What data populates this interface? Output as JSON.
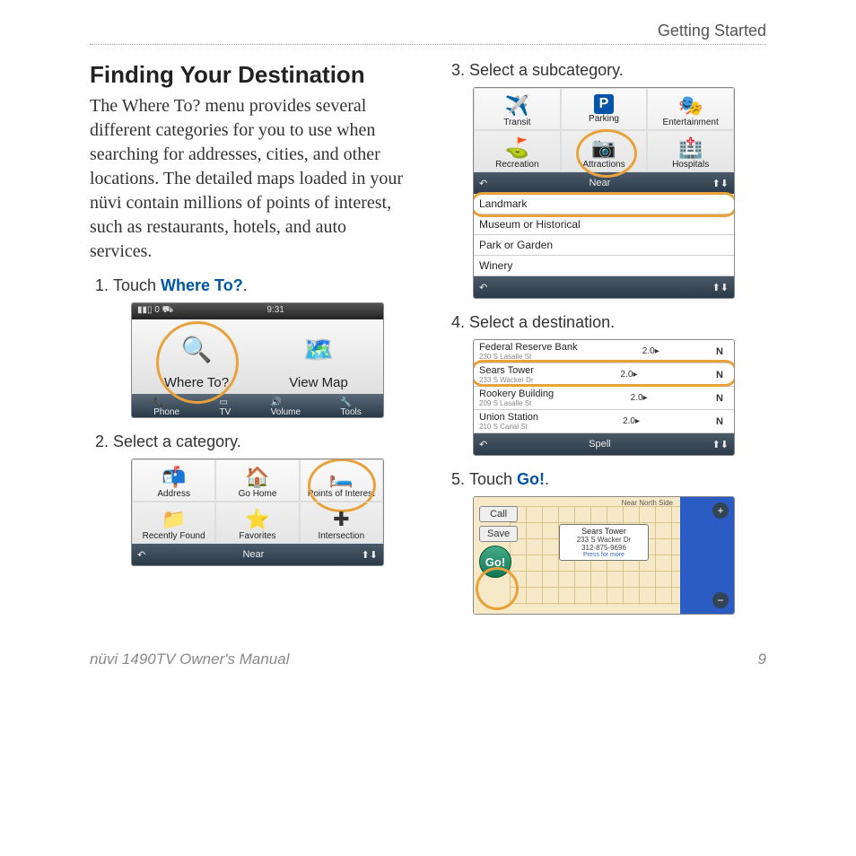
{
  "header": {
    "section": "Getting Started"
  },
  "title": "Finding Your Destination",
  "intro": "The Where To? menu provides several different categories for you to use when searching for addresses, cities, and other locations. The detailed maps loaded in your nüvi contain millions of points of interest, such as restaurants, hotels, and auto services.",
  "steps": {
    "s1": {
      "num": "1.",
      "prefix": "Touch ",
      "link": "Where To?",
      "suffix": "."
    },
    "s2": {
      "num": "2.",
      "text": "Select a category."
    },
    "s3": {
      "num": "3.",
      "text": "Select a subcategory."
    },
    "s4": {
      "num": "4.",
      "text": "Select a destination."
    },
    "s5": {
      "num": "5.",
      "prefix": "Touch ",
      "link": "Go!",
      "suffix": "."
    }
  },
  "home_screen": {
    "time": "9:31",
    "where_to": "Where To?",
    "view_map": "View Map",
    "bottom": [
      "Phone",
      "TV",
      "Volume",
      "Tools"
    ]
  },
  "categories": {
    "items": [
      "Address",
      "Go Home",
      "Points of Interest",
      "Recently Found",
      "Favorites",
      "Intersection"
    ],
    "nav_mid": "Near"
  },
  "subcategories": {
    "items": [
      "Transit",
      "Parking",
      "Entertainment",
      "Recreation",
      "Attractions",
      "Hospitals"
    ],
    "nav_mid": "Near",
    "list": [
      "Landmark",
      "Museum or Historical",
      "Park or Garden",
      "Winery"
    ]
  },
  "destinations": {
    "rows": [
      {
        "name": "Federal Reserve Bank",
        "addr": "230 S Lasalle St",
        "dist": "2.0",
        "dir": "N"
      },
      {
        "name": "Sears Tower",
        "addr": "233 S Wacker Dr",
        "dist": "2.0",
        "dir": "N"
      },
      {
        "name": "Rookery Building",
        "addr": "209 S Lasalle St",
        "dist": "2.0",
        "dir": "N"
      },
      {
        "name": "Union Station",
        "addr": "210 S Canal St",
        "dist": "2.0",
        "dir": "N"
      }
    ],
    "nav_mid": "Spell"
  },
  "map": {
    "call": "Call",
    "save": "Save",
    "go": "Go!",
    "callout": {
      "name": "Sears Tower",
      "addr": "233 S Wacker Dr",
      "phone": "312-875-9696",
      "more": "Press for more"
    },
    "near": "Near North Side"
  },
  "footer": {
    "manual": "nüvi 1490TV Owner's Manual",
    "page": "9"
  }
}
